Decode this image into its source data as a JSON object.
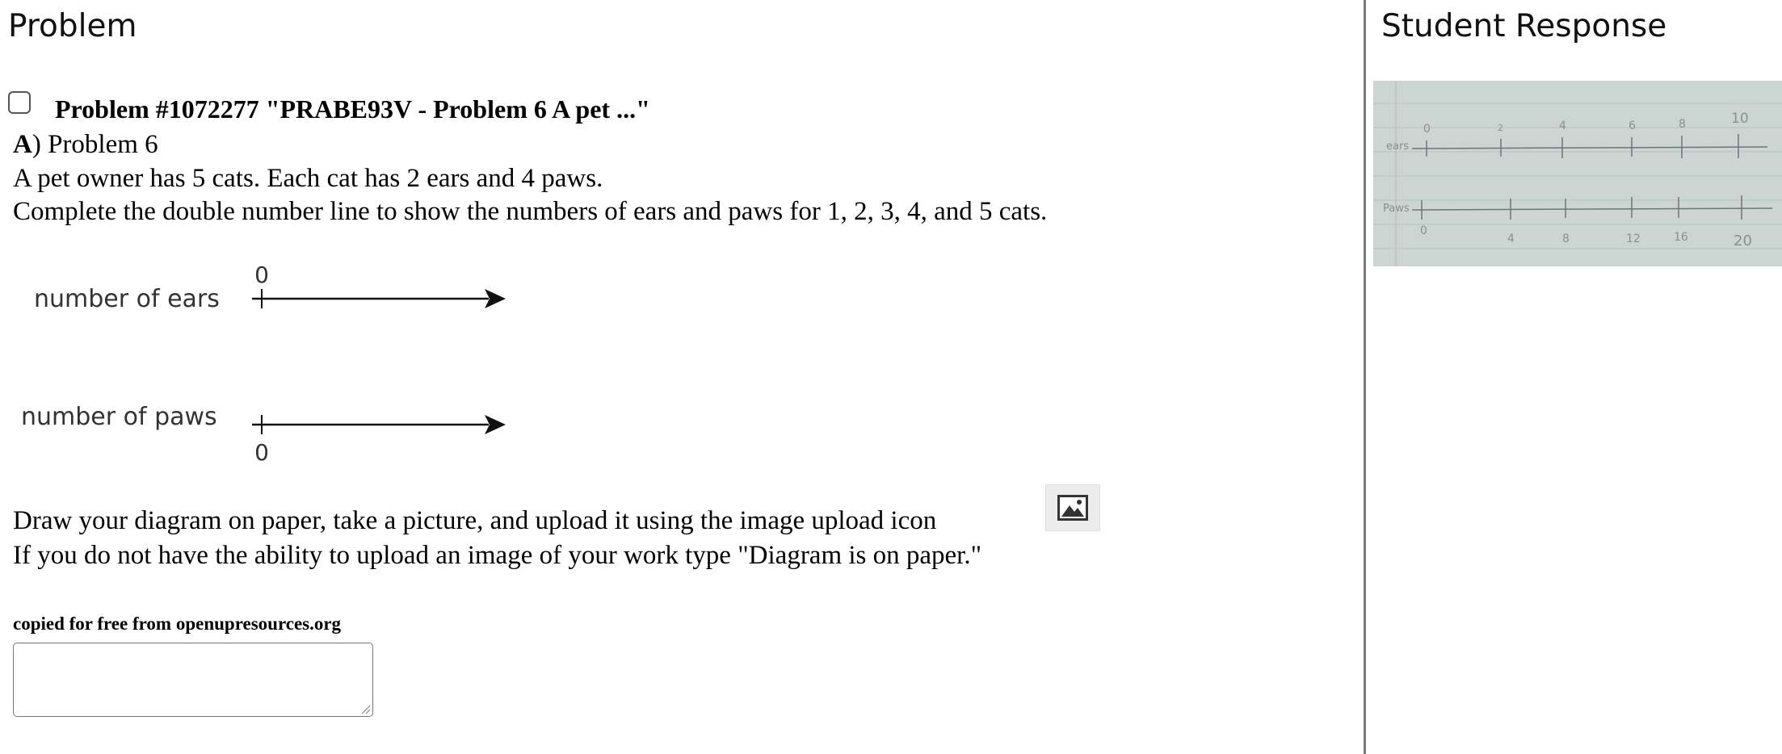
{
  "problem_panel": {
    "title": "Problem",
    "problem_header": "Problem #1072277 \"PRABE93V - Problem 6 A pet ...\"",
    "part_letter": "A",
    "part_title": ") Problem 6",
    "line1": "A pet owner has 5 cats. Each cat has 2 ears and 4 paws.",
    "line2": "Complete the double number line to show the numbers of ears and paws for 1, 2, 3, 4, and 5 cats.",
    "diagram": {
      "ears_label": "number of ears",
      "ears_zero": "0",
      "paws_label": "number of paws",
      "paws_zero": "0"
    },
    "instruction1": "Draw your diagram on paper, take a picture, and upload it using the image upload icon",
    "instruction2": "If you do not have the ability to upload an image of your work type \"Diagram is on paper.\"",
    "upload_icon": "image-upload-icon",
    "credit": "copied for free from openupresources.org",
    "answer_value": ""
  },
  "student_panel": {
    "title": "Student Response",
    "photo": {
      "ears_label": "ears",
      "paws_label": "Paws",
      "ears_ticks": [
        "0",
        "2",
        "4",
        "6",
        "8",
        "10"
      ],
      "paws_ticks": [
        "0",
        "4",
        "8",
        "12",
        "16",
        "20"
      ]
    }
  },
  "colors": {
    "divider": "#7a7a7a",
    "photo_background": "#cdd5d3"
  }
}
